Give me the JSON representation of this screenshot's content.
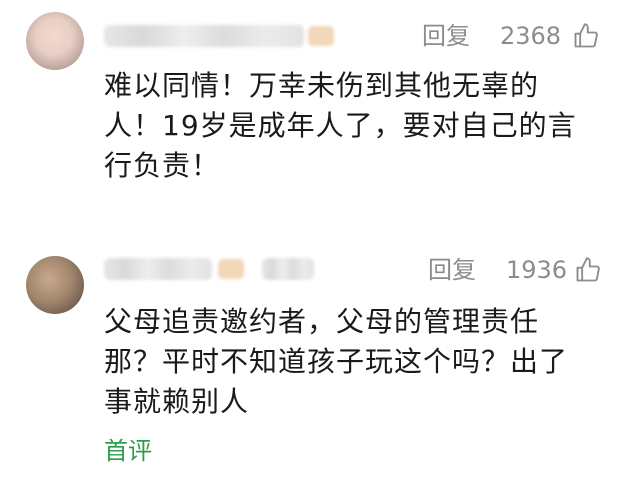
{
  "comments": [
    {
      "reply_label": "回复",
      "likes": "2368",
      "lines": [
        "难以同情！万幸未伤到其他无辜的",
        "人！19岁是成年人了，要对自己的言",
        "行负责！"
      ]
    },
    {
      "reply_label": "回复",
      "likes": "1936",
      "lines": [
        "父母追责邀约者，父母的管理责任",
        "那？平时不知道孩子玩这个吗？出了",
        "事就赖别人"
      ],
      "tag": "首评"
    }
  ],
  "colors": {
    "meta_gray": "#8c8c8c",
    "tag_green": "#2e9c4d",
    "text": "#1a1a1a"
  }
}
